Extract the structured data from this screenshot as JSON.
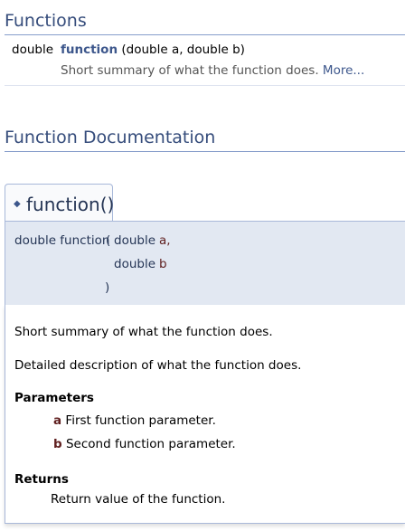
{
  "sections": {
    "functions_title": "Functions",
    "documentation_title": "Function Documentation"
  },
  "summary": {
    "return_type": "double",
    "function_name": "function",
    "signature_rest": "(double a, double b)",
    "description": "Short summary of what the function does.",
    "more_link": "More..."
  },
  "member": {
    "title": "function()",
    "bullet": "◆",
    "prototype": {
      "return_and_name": "double function",
      "open_paren": "(",
      "param1_type": "double",
      "param1_name": "a,",
      "param2_type": "double",
      "param2_name": "b",
      "close_paren": ")"
    },
    "brief": "Short summary of what the function does.",
    "detailed": "Detailed description of what the function does.",
    "parameters_heading": "Parameters",
    "parameters": [
      {
        "name": "a",
        "description": "First function parameter."
      },
      {
        "name": "b",
        "description": "Second function parameter."
      }
    ],
    "returns_heading": "Returns",
    "returns": "Return value of the function."
  },
  "colors": {
    "heading": "#354c7b",
    "link": "#3d578c",
    "param_name": "#602020",
    "proto_bg": "#e2e8f2",
    "border": "#a8b8d9"
  }
}
